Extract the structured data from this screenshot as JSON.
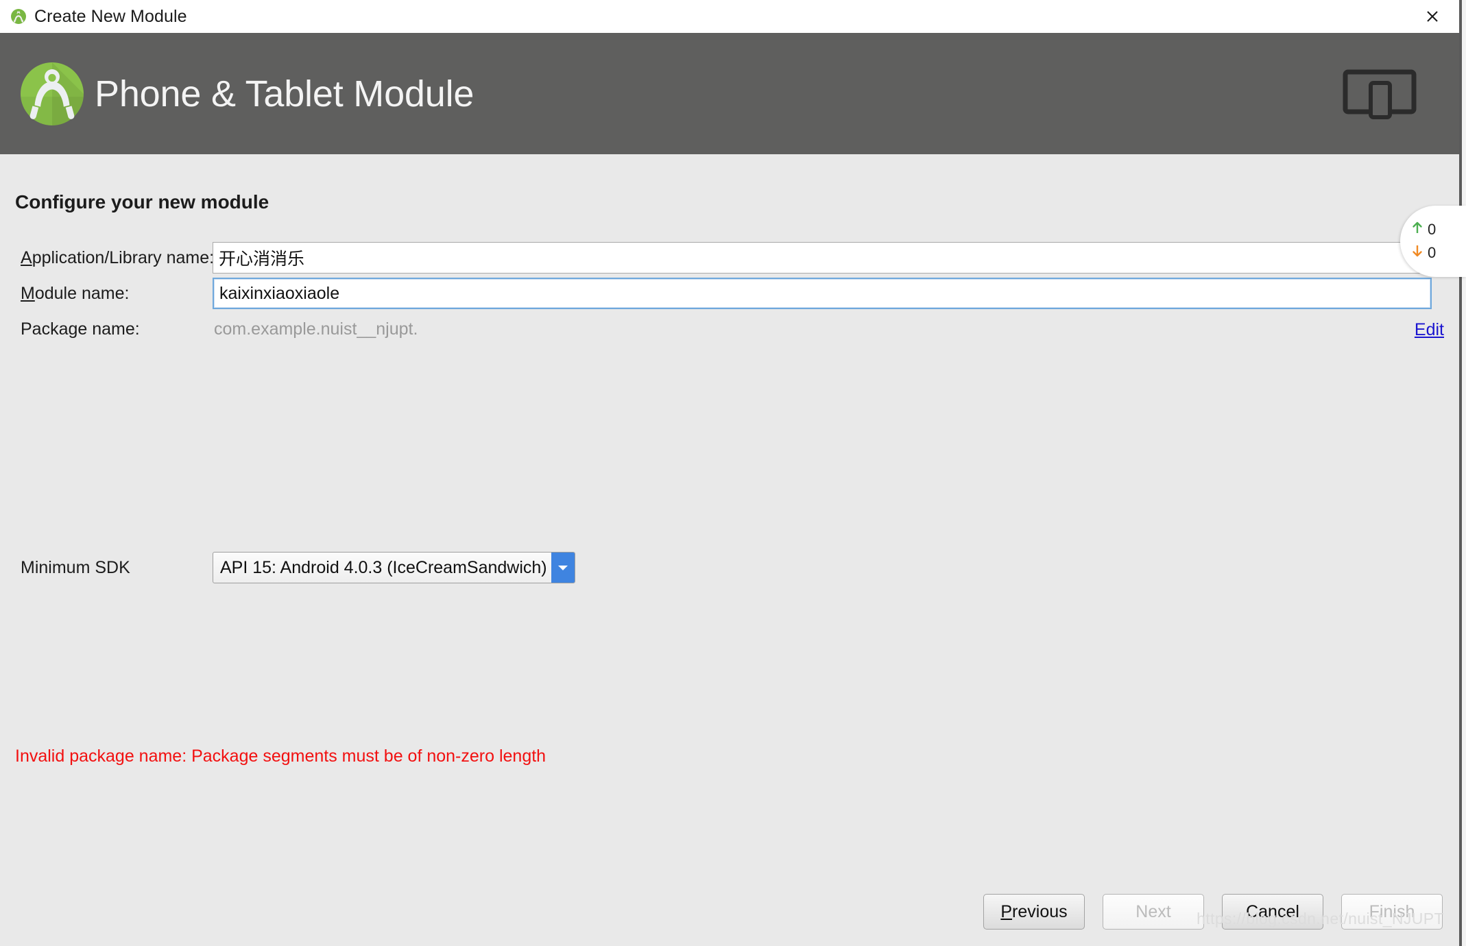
{
  "window": {
    "title": "Create New Module",
    "title_icon": "android-studio-icon",
    "close_icon": "close-icon"
  },
  "header": {
    "title": "Phone & Tablet Module",
    "logo_icon": "android-studio-logo-icon",
    "device_icon": "phone-tablet-icon",
    "background_color": "#5f5f5e"
  },
  "body": {
    "step_title": "Configure your new module",
    "fields": {
      "app_name": {
        "label_mnemonic": "A",
        "label_rest": "pplication/Library name:",
        "value": "开心消消乐",
        "placeholder": ""
      },
      "module_name": {
        "label_mnemonic": "M",
        "label_rest": "odule name:",
        "value": "kaixinxiaoxiaole",
        "placeholder": ""
      },
      "package_name": {
        "label": "Package name:",
        "value": "com.example.nuist__njupt.",
        "edit_link": "Edit",
        "edit_link_color": "#1a14d0"
      },
      "min_sdk": {
        "label": "Minimum SDK",
        "selected": "API 15: Android 4.0.3 (IceCreamSandwich)",
        "arrow_icon": "chevron-down-icon",
        "arrow_color": "#3f84e0"
      }
    },
    "error": {
      "message": "Invalid package name: Package segments must be of non-zero length",
      "color": "#f21010"
    }
  },
  "footer": {
    "buttons": [
      {
        "mnemonic": "P",
        "rest": "revious",
        "enabled": true
      },
      {
        "mnemonic": "",
        "rest": "Next",
        "enabled": false
      },
      {
        "mnemonic": "",
        "rest": "Cancel",
        "enabled": true
      },
      {
        "mnemonic": "",
        "rest": "Finish",
        "enabled": false
      }
    ],
    "watermark": "https://blog.csdn.net/nuist_NJUPT"
  },
  "overlay": {
    "upload_icon": "arrow-up-icon",
    "upload_value": "0",
    "download_icon": "arrow-down-icon",
    "download_value": "0",
    "upload_color": "#4caf50",
    "download_color": "#f08a24"
  }
}
